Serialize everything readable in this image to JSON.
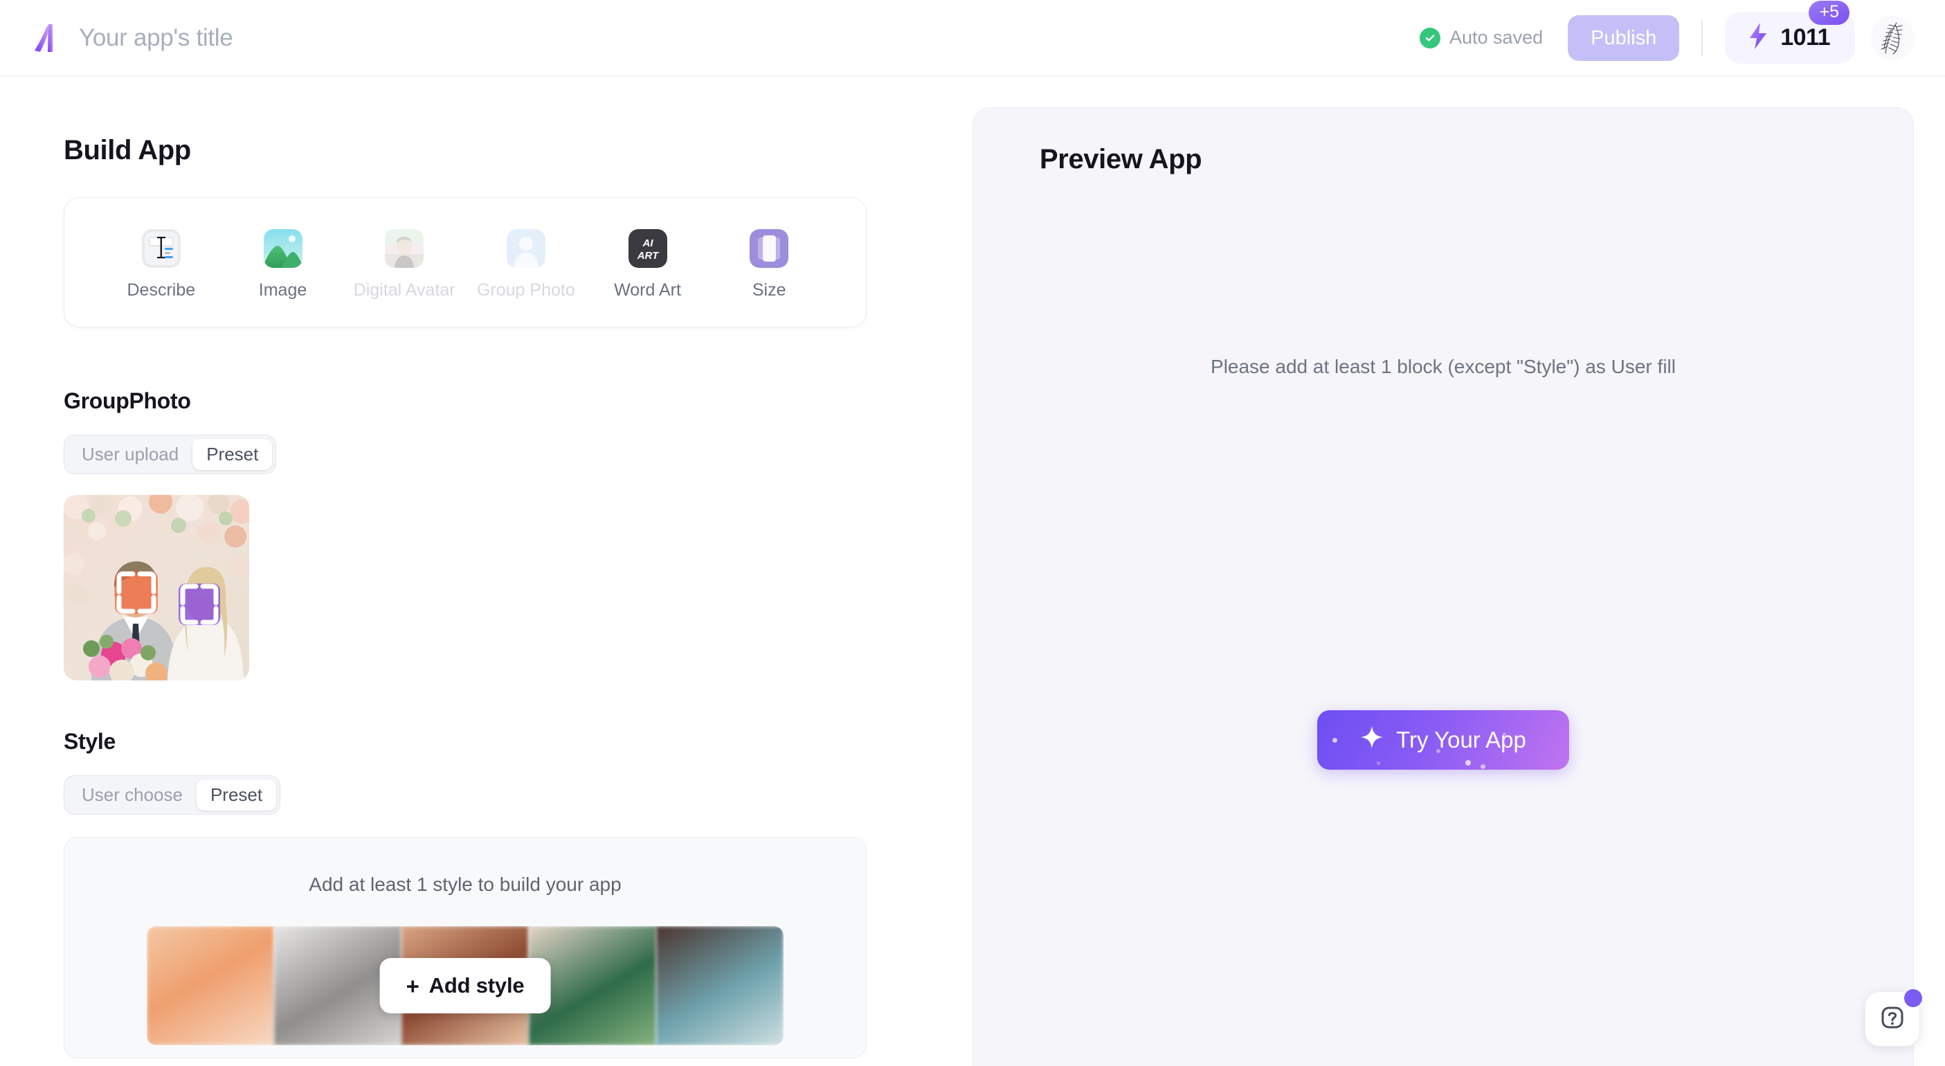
{
  "header": {
    "logo_icon": "app-logo-icon",
    "app_title": "Your app's title",
    "autosave_icon": "check-circle-icon",
    "autosave_label": "Auto saved",
    "publish_label": "Publish",
    "credits_icon": "lightning-bolt-icon",
    "credits_value": "1011",
    "credits_badge": "+5",
    "avatar_icon": "user-avatar"
  },
  "build": {
    "title": "Build App",
    "blocks": [
      {
        "label": "Describe",
        "icon": "describe-icon",
        "disabled": false
      },
      {
        "label": "Image",
        "icon": "image-icon",
        "disabled": false
      },
      {
        "label": "Digital Avatar",
        "icon": "digital-avatar-icon",
        "disabled": true
      },
      {
        "label": "Group Photo",
        "icon": "group-photo-icon",
        "disabled": true
      },
      {
        "label": "Word Art",
        "icon": "word-art-icon",
        "disabled": false
      },
      {
        "label": "Size",
        "icon": "size-icon",
        "disabled": false
      }
    ],
    "group_photo": {
      "title": "GroupPhoto",
      "toggle": {
        "options": [
          "User upload",
          "Preset"
        ],
        "selected": "Preset"
      },
      "thumbnail_alt": "wedding-couple-photo-with-face-boxes"
    },
    "style": {
      "title": "Style",
      "toggle": {
        "options": [
          "User choose",
          "Preset"
        ],
        "selected": "Preset"
      },
      "hint": "Add at least 1 style to build your app",
      "add_button": {
        "plus": "+",
        "label": "Add style"
      },
      "thumbnail_colors": [
        "#e8a376",
        "#b9b7b4",
        "#b4796a",
        "#4e7d5c",
        "#5f9aa3"
      ]
    }
  },
  "preview": {
    "title": "Preview App",
    "message": "Please add at least 1 block (except \"Style\") as User fill",
    "try_button": {
      "icon": "sparkle-star-icon",
      "label": "Try Your App"
    }
  },
  "help": {
    "icon": "question-mark-icon",
    "badge_icon": "notification-dot"
  },
  "colors": {
    "accent_purple": "#7c5cf5",
    "publish_bg": "#c4c0f7",
    "success_green": "#34c77b",
    "panel_bg": "#f5f5fa",
    "text_dark": "#15151f",
    "text_muted": "#9aa0ad"
  }
}
